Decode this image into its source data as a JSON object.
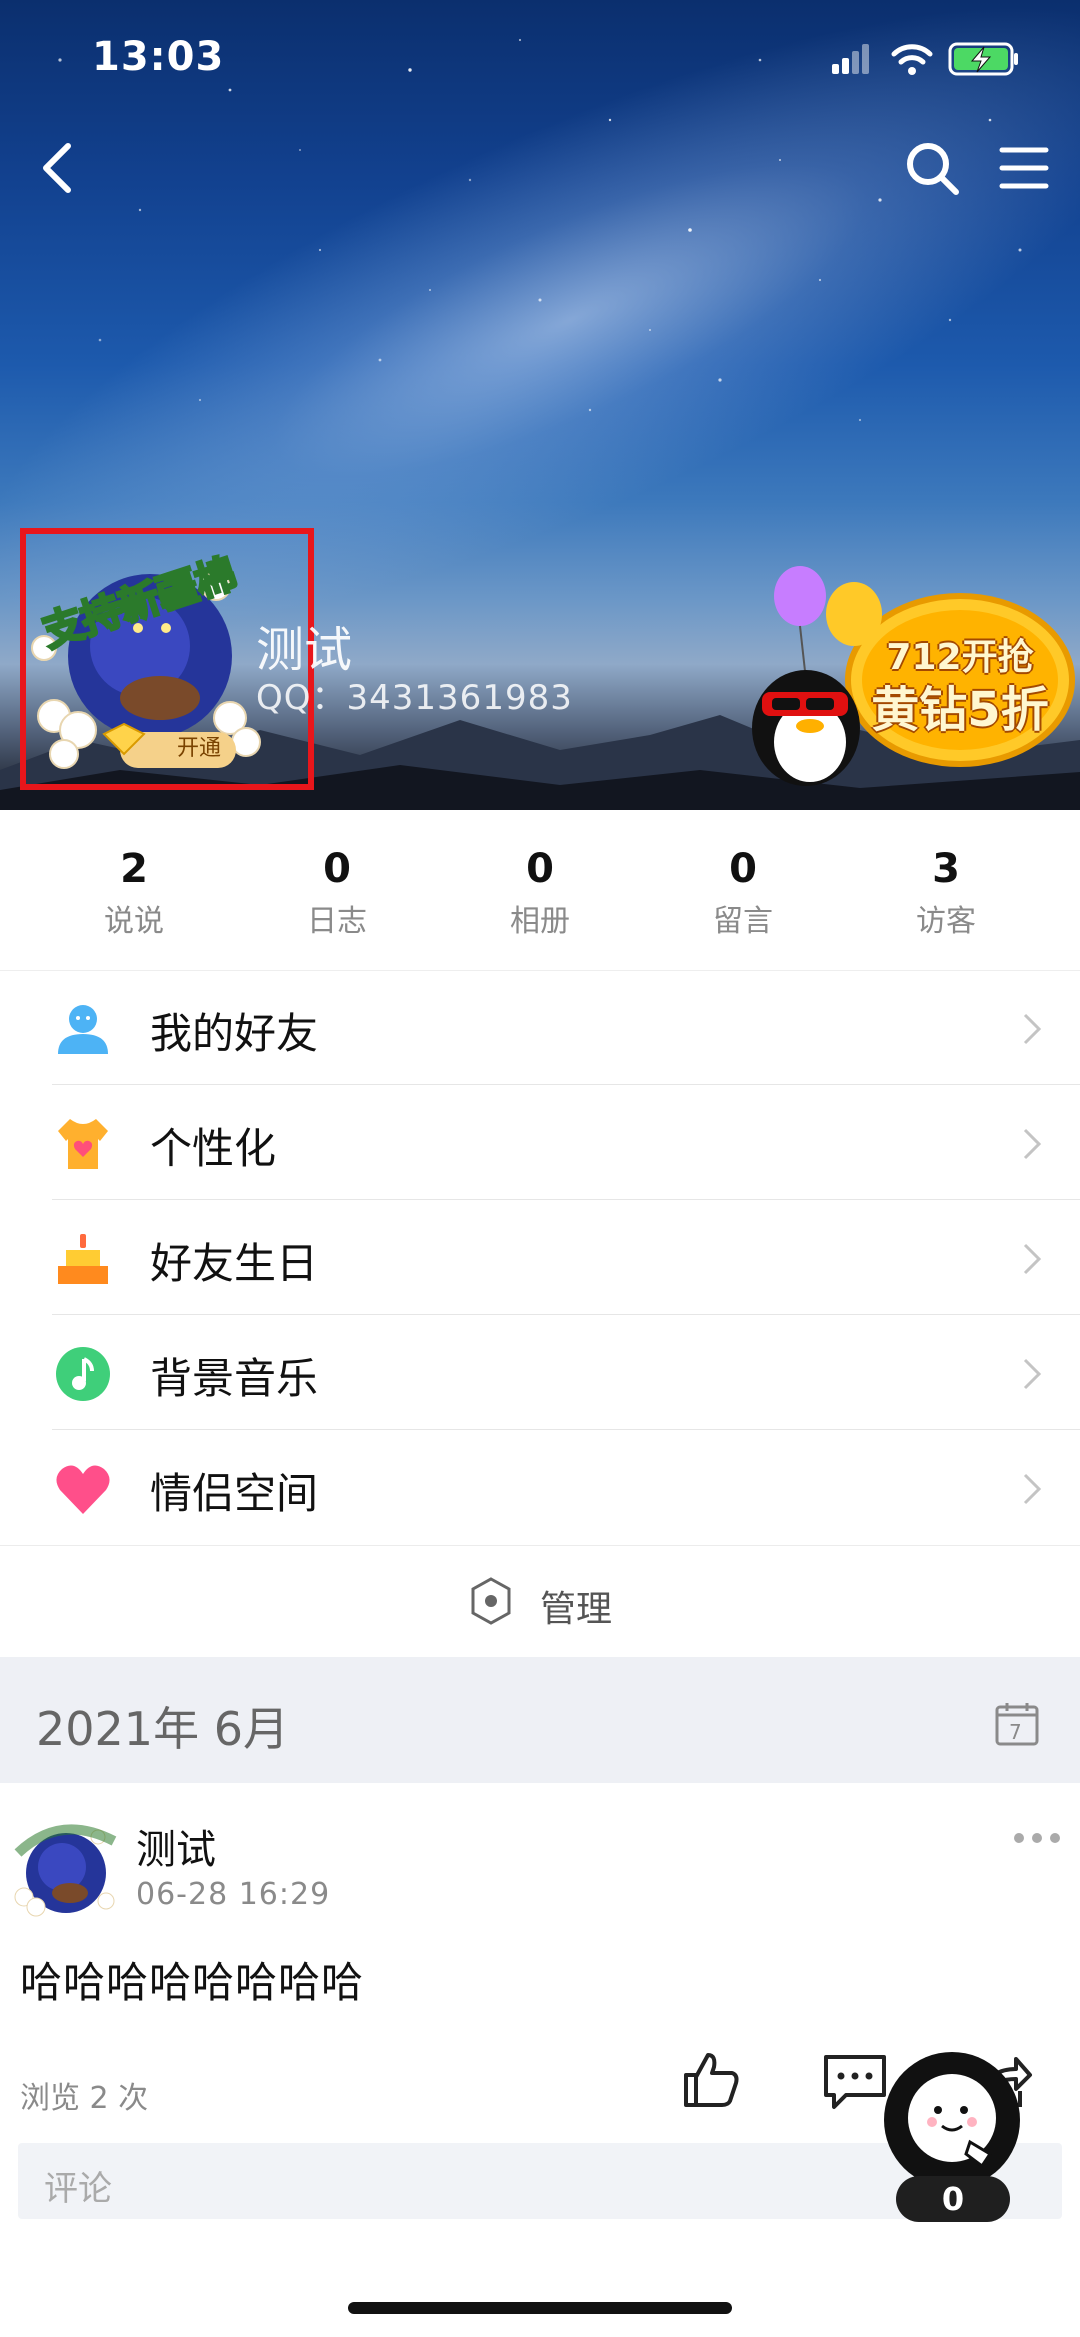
{
  "status_bar": {
    "time": "13:03"
  },
  "profile": {
    "name": "测试",
    "qq": "QQ：3431361983",
    "avatar_caption": "支持新疆棉",
    "open_badge": "开通"
  },
  "promo": {
    "line1": "712开抢",
    "line2": "黄钻5折"
  },
  "stats": [
    {
      "num": "2",
      "label": "说说"
    },
    {
      "num": "0",
      "label": "日志"
    },
    {
      "num": "0",
      "label": "相册"
    },
    {
      "num": "0",
      "label": "留言"
    },
    {
      "num": "3",
      "label": "访客"
    }
  ],
  "menu": [
    {
      "label": "我的好友",
      "icon": "friend-icon"
    },
    {
      "label": "个性化",
      "icon": "tshirt-icon"
    },
    {
      "label": "好友生日",
      "icon": "birthday-cake-icon"
    },
    {
      "label": "背景音乐",
      "icon": "music-note-icon"
    },
    {
      "label": "情侣空间",
      "icon": "heart-icon"
    }
  ],
  "manage": {
    "label": "管理"
  },
  "feed": {
    "month": "2021年 6月",
    "post": {
      "author": "测试",
      "time": "06-28 16:29",
      "text": "哈哈哈哈哈哈哈哈",
      "views": "浏览 2 次",
      "comment_placeholder": "评论"
    }
  },
  "float_widget": {
    "count": "0"
  },
  "colors": {
    "highlight_frame": "#e8161b",
    "month_bar": "#eef0f5"
  }
}
